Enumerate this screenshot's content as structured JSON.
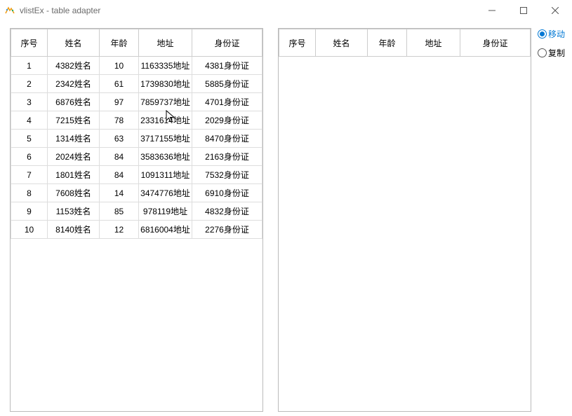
{
  "window": {
    "title": "vlistEx - table adapter"
  },
  "columns": {
    "seq": "序号",
    "name": "姓名",
    "age": "年龄",
    "addr": "地址",
    "id": "身份证"
  },
  "radios": {
    "move": "移动",
    "copy": "复制",
    "selected": "move"
  },
  "left_rows": [
    {
      "seq": "1",
      "name": "4382姓名",
      "age": "10",
      "addr": "1163335地址",
      "id": "4381身份证"
    },
    {
      "seq": "2",
      "name": "2342姓名",
      "age": "61",
      "addr": "1739830地址",
      "id": "5885身份证"
    },
    {
      "seq": "3",
      "name": "6876姓名",
      "age": "97",
      "addr": "7859737地址",
      "id": "4701身份证"
    },
    {
      "seq": "4",
      "name": "7215姓名",
      "age": "78",
      "addr": "2331614地址",
      "id": "2029身份证"
    },
    {
      "seq": "5",
      "name": "1314姓名",
      "age": "63",
      "addr": "3717155地址",
      "id": "8470身份证"
    },
    {
      "seq": "6",
      "name": "2024姓名",
      "age": "84",
      "addr": "3583636地址",
      "id": "2163身份证"
    },
    {
      "seq": "7",
      "name": "1801姓名",
      "age": "84",
      "addr": "1091311地址",
      "id": "7532身份证"
    },
    {
      "seq": "8",
      "name": "7608姓名",
      "age": "14",
      "addr": "3474776地址",
      "id": "6910身份证"
    },
    {
      "seq": "9",
      "name": "1153姓名",
      "age": "85",
      "addr": "978119地址",
      "id": "4832身份证"
    },
    {
      "seq": "10",
      "name": "8140姓名",
      "age": "12",
      "addr": "6816004地址",
      "id": "2276身份证"
    }
  ],
  "right_rows": []
}
